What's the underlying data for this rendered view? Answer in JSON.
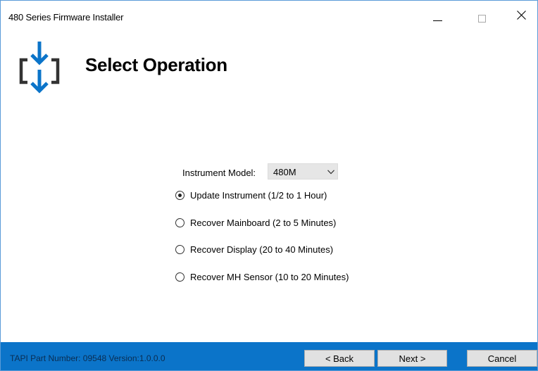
{
  "window": {
    "title": "480 Series Firmware Installer",
    "minimize_symbol": "—",
    "close_symbol": "✕"
  },
  "header": {
    "title": "Select Operation",
    "icon": "download-bracket-icon",
    "accent_color": "#0b74c9"
  },
  "form": {
    "model_label": "Instrument Model:",
    "model_value": "480M",
    "options": [
      {
        "label": "Update Instrument (1/2 to 1 Hour)",
        "selected": true
      },
      {
        "label": "Recover Mainboard (2 to 5 Minutes)",
        "selected": false
      },
      {
        "label": "Recover Display (20 to 40 Minutes)",
        "selected": false
      },
      {
        "label": "Recover MH Sensor (10 to 20 Minutes)",
        "selected": false
      }
    ]
  },
  "footer": {
    "info": "TAPI Part Number: 09548  Version:1.0.0.0",
    "back_label": "< Back",
    "next_label": "Next >",
    "cancel_label": "Cancel",
    "background_color": "#0b74c9"
  }
}
